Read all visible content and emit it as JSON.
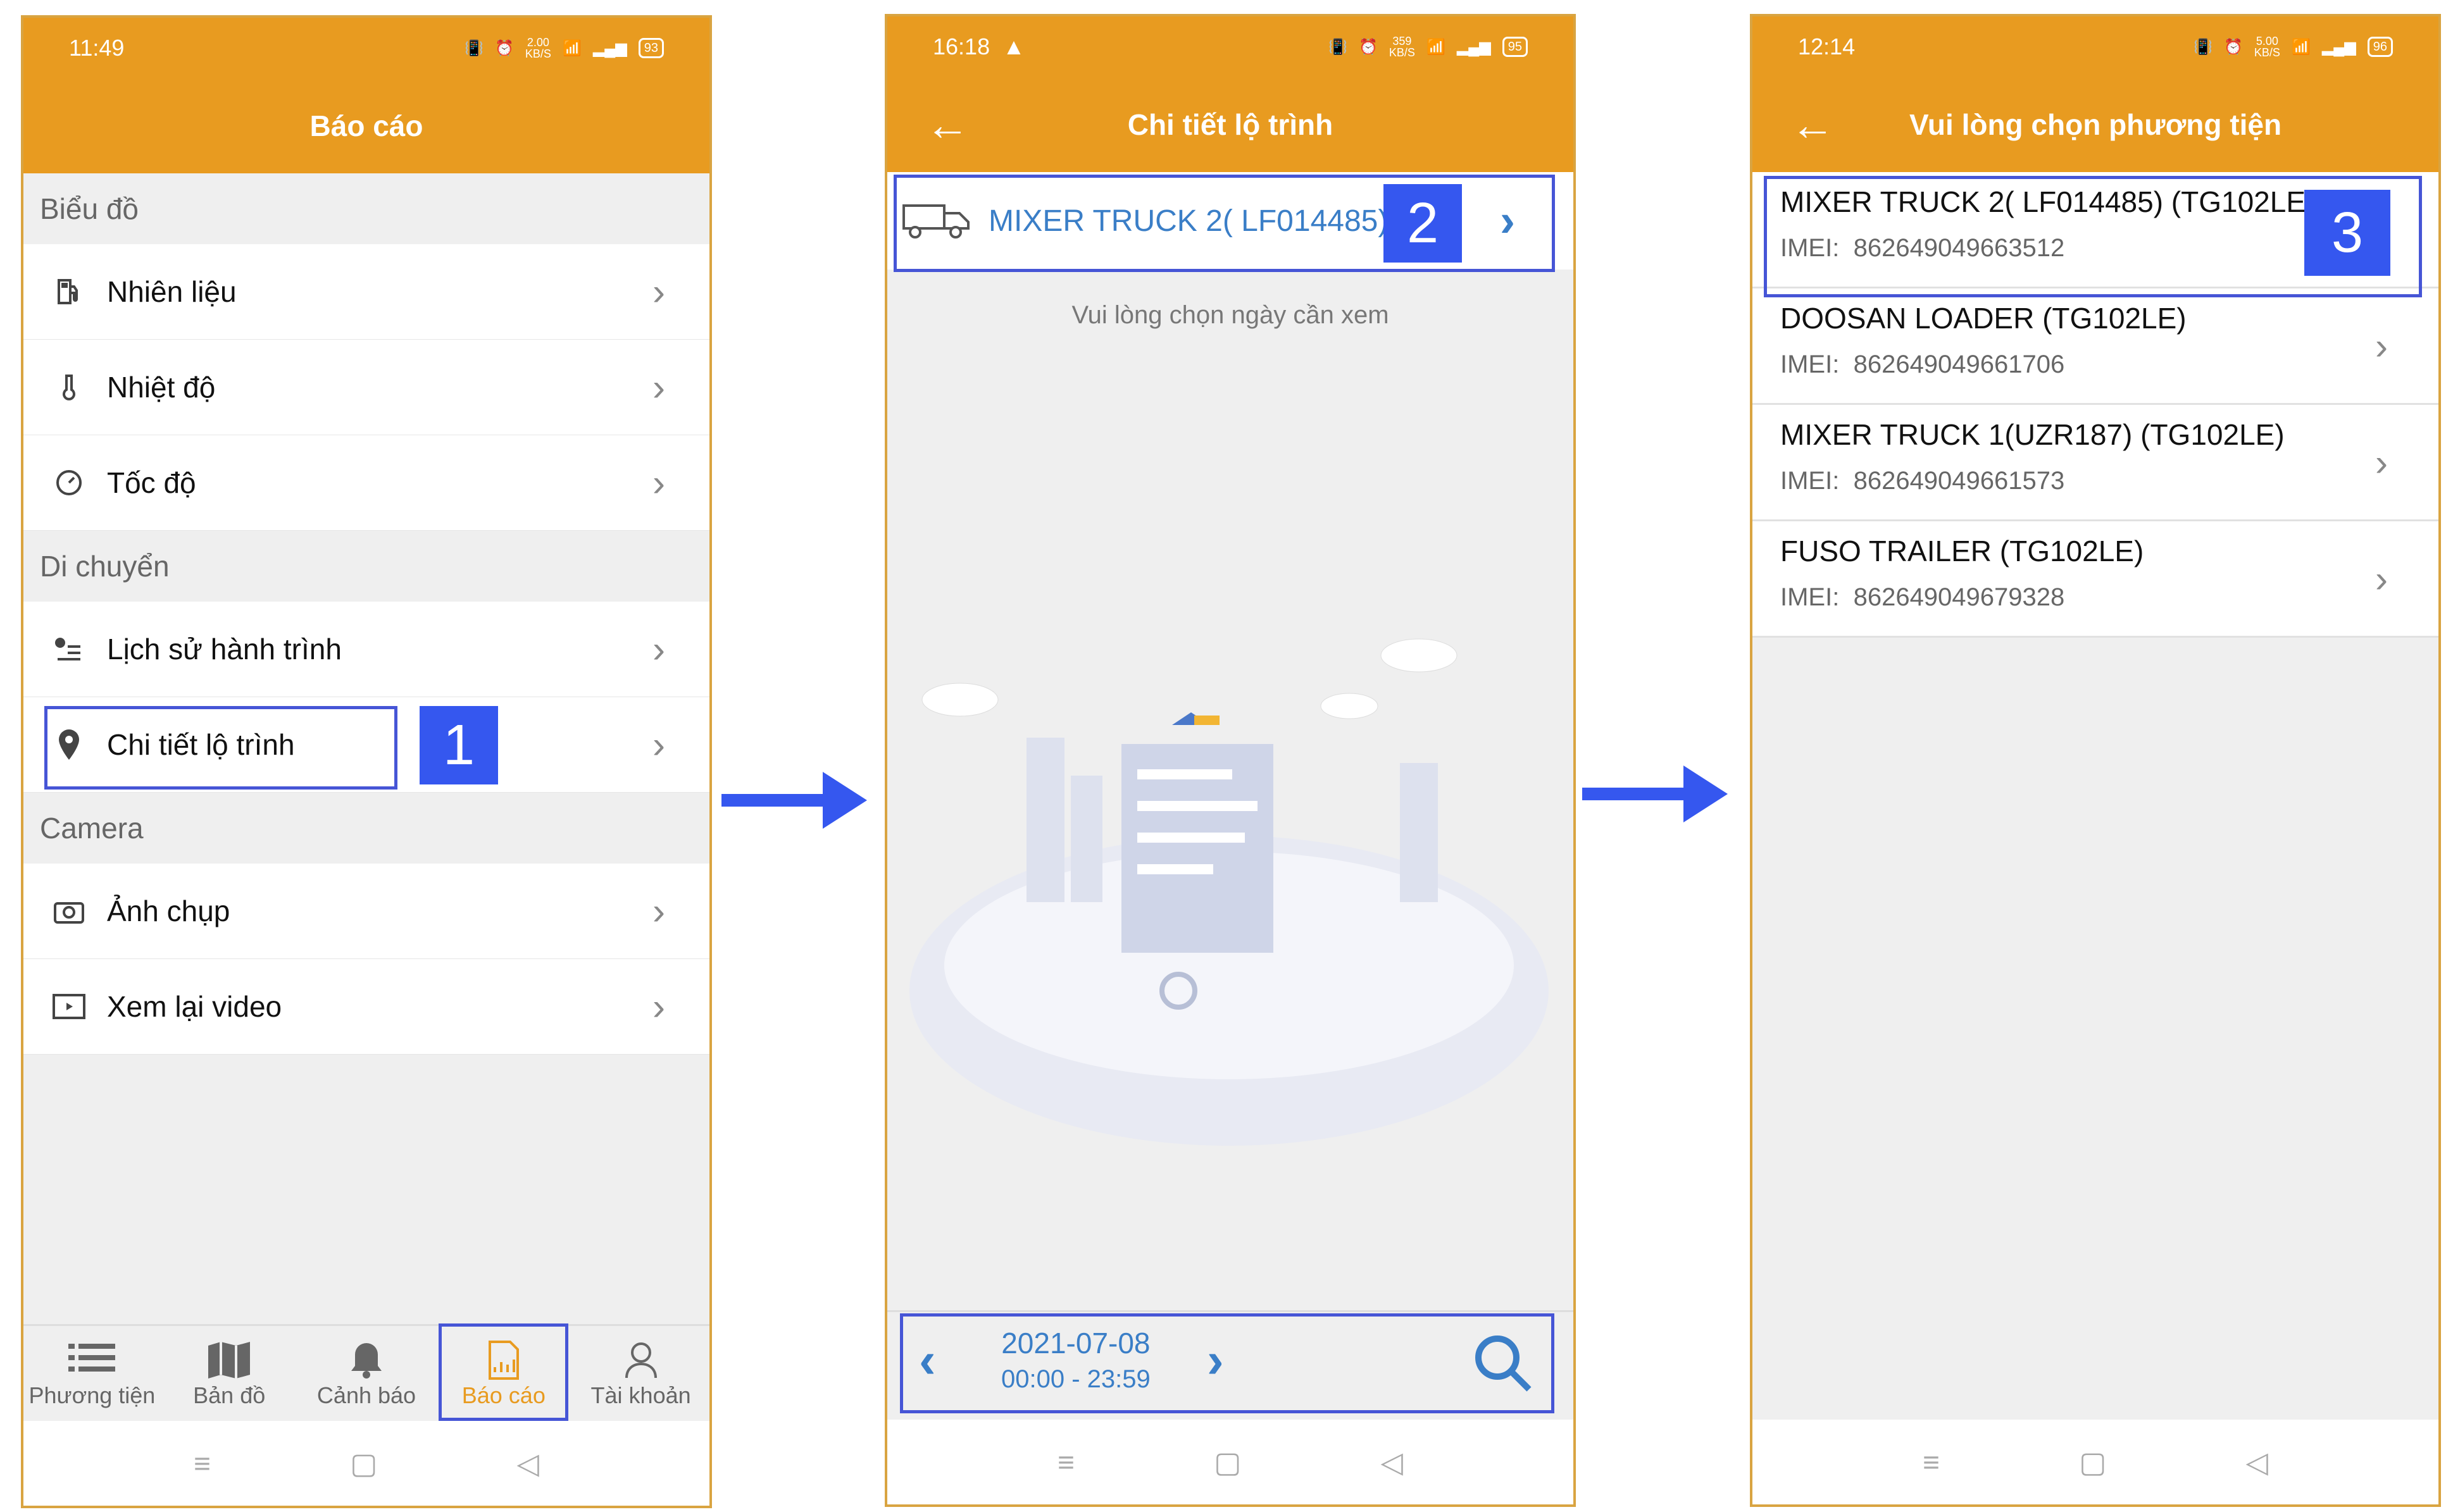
{
  "screens": [
    {
      "status_time": "11:49",
      "status_speed": "2.00",
      "battery": "93",
      "title": "Báo cáo",
      "sections": [
        {
          "label": "Biểu đồ",
          "items": [
            {
              "label": "Nhiên liệu",
              "icon": "fuel-icon"
            },
            {
              "label": "Nhiệt độ",
              "icon": "thermometer-icon"
            },
            {
              "label": "Tốc độ",
              "icon": "speedometer-icon"
            }
          ]
        },
        {
          "label": "Di chuyển",
          "items": [
            {
              "label": "Lịch sử hành trình",
              "icon": "route-history-icon"
            },
            {
              "label": "Chi tiết lộ trình",
              "icon": "location-pin-icon"
            }
          ]
        },
        {
          "label": "Camera",
          "items": [
            {
              "label": "Ảnh chụp",
              "icon": "camera-icon"
            },
            {
              "label": "Xem lại video",
              "icon": "video-icon"
            }
          ]
        }
      ],
      "tabs": [
        {
          "label": "Phương tiện",
          "icon": "list-icon"
        },
        {
          "label": "Bản đồ",
          "icon": "map-icon"
        },
        {
          "label": "Cảnh báo",
          "icon": "bell-icon"
        },
        {
          "label": "Báo cáo",
          "icon": "report-chart-icon"
        },
        {
          "label": "Tài khoản",
          "icon": "user-icon"
        }
      ],
      "step": "1"
    },
    {
      "status_time": "16:18",
      "status_speed": "359",
      "battery": "95",
      "title": "Chi tiết lộ trình",
      "vehicle": "MIXER TRUCK 2( LF014485)",
      "hint": "Vui lòng chọn ngày cần xem",
      "date": "2021-07-08",
      "time_range": "00:00 - 23:59",
      "step": "2"
    },
    {
      "status_time": "12:14",
      "status_speed": "5.00",
      "battery": "96",
      "title": "Vui lòng chọn phương tiện",
      "imei_label": "IMEI:",
      "vehicles": [
        {
          "name": "MIXER TRUCK 2( LF014485) (TG102LE)",
          "imei": "862649049663512"
        },
        {
          "name": "DOOSAN LOADER (TG102LE)",
          "imei": "862649049661706"
        },
        {
          "name": "MIXER TRUCK 1(UZR187) (TG102LE)",
          "imei": "862649049661573"
        },
        {
          "name": "FUSO TRAILER (TG102LE)",
          "imei": "862649049679328"
        }
      ],
      "step": "3"
    }
  ],
  "speed_unit": "KB/S",
  "colors": {
    "accent": "#e89b20",
    "highlight": "#3557ef",
    "link": "#3a7ec7"
  }
}
